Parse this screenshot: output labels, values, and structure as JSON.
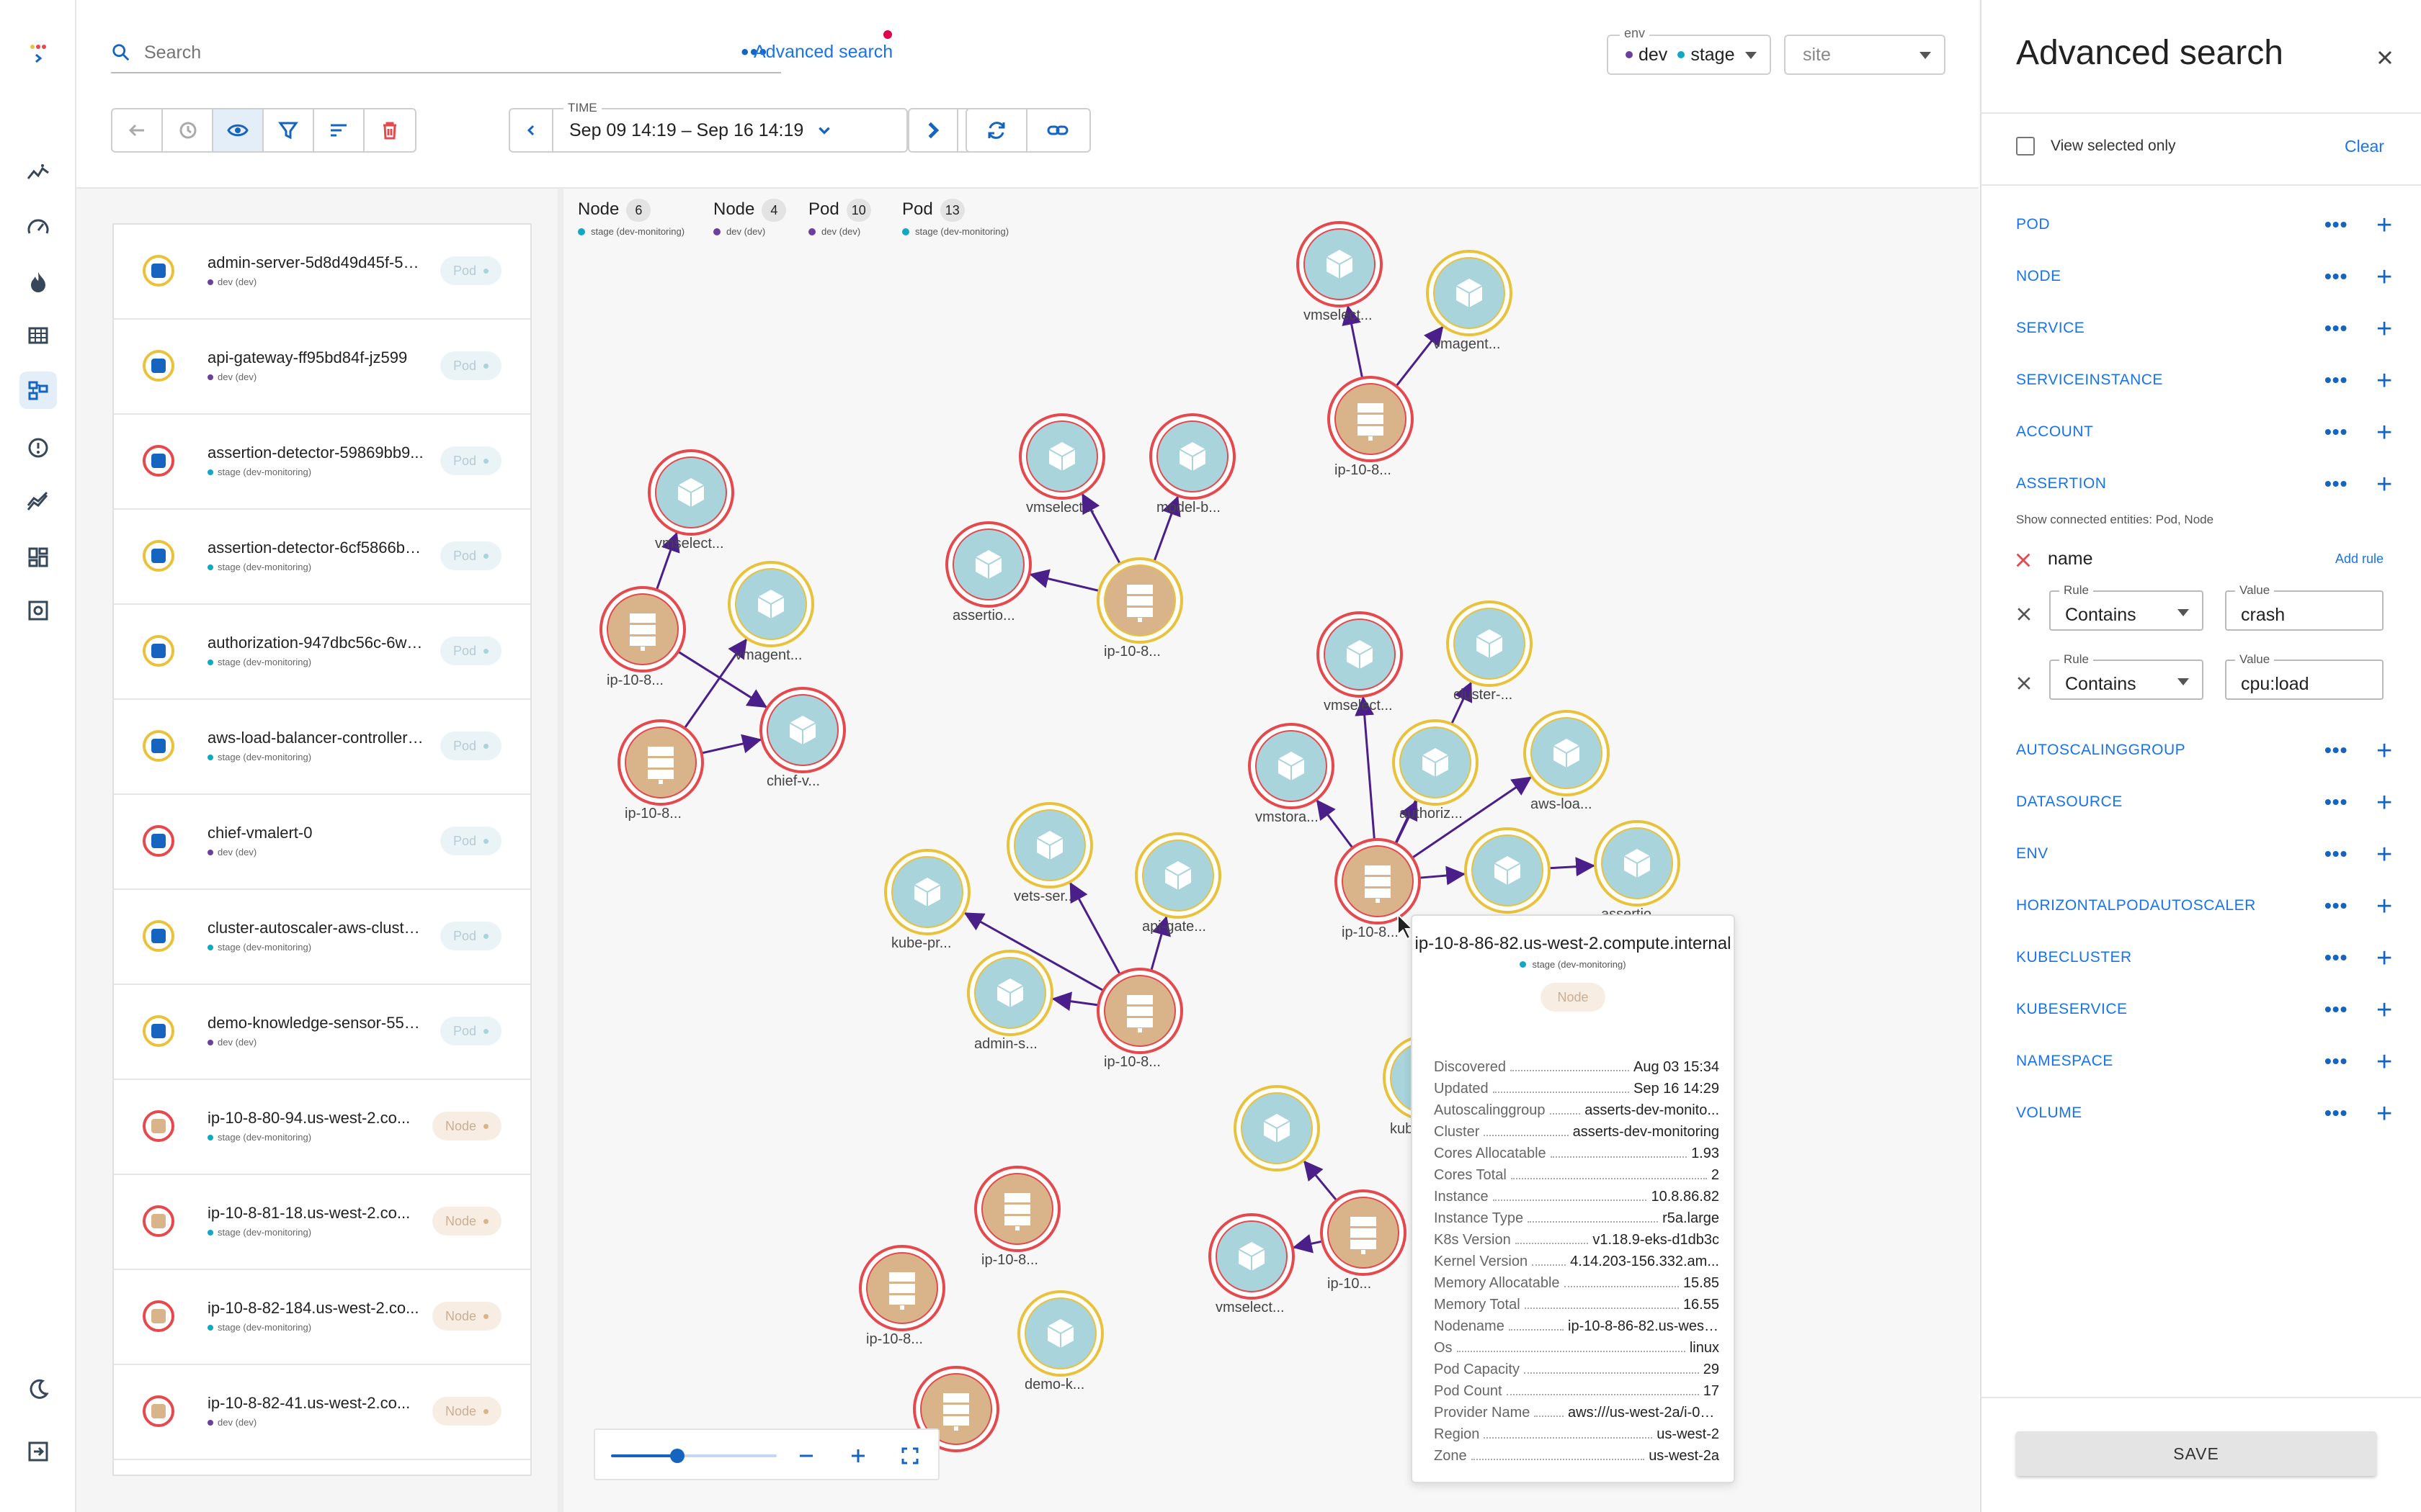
{
  "header": {
    "search_placeholder": "Search",
    "advanced_search_link": "Advanced search",
    "env_label": "env",
    "env_values": [
      "dev",
      "stage"
    ],
    "site_placeholder": "site",
    "time_label": "TIME",
    "time_range": "Sep 09 14:19 – Sep 16 14:19"
  },
  "colors": {
    "accent": "#1a73e8",
    "dev": "#6b3fa0",
    "stage": "#12a7c4",
    "pod_fill": "#a9d4dc",
    "node_fill": "#d9b48a",
    "ring_red": "#e5484d",
    "ring_yellow": "#e8c23a",
    "edge": "#4a1f8a"
  },
  "entities": [
    {
      "name": "admin-server-5d8d49d45f-56...",
      "scope": "dev (dev)",
      "env": "dev",
      "type": "Pod",
      "ring": "yellow"
    },
    {
      "name": "api-gateway-ff95bd84f-jz599",
      "scope": "dev (dev)",
      "env": "dev",
      "type": "Pod",
      "ring": "yellow"
    },
    {
      "name": "assertion-detector-59869bb9...",
      "scope": "stage (dev-monitoring)",
      "env": "stage",
      "type": "Pod",
      "ring": "red"
    },
    {
      "name": "assertion-detector-6cf5866b8...",
      "scope": "stage (dev-monitoring)",
      "env": "stage",
      "type": "Pod",
      "ring": "yellow"
    },
    {
      "name": "authorization-947dbc56c-6wl5z",
      "scope": "stage (dev-monitoring)",
      "env": "stage",
      "type": "Pod",
      "ring": "yellow"
    },
    {
      "name": "aws-load-balancer-controller-...",
      "scope": "stage (dev-monitoring)",
      "env": "stage",
      "type": "Pod",
      "ring": "yellow"
    },
    {
      "name": "chief-vmalert-0",
      "scope": "dev (dev)",
      "env": "dev",
      "type": "Pod",
      "ring": "red"
    },
    {
      "name": "cluster-autoscaler-aws-cluste...",
      "scope": "stage (dev-monitoring)",
      "env": "stage",
      "type": "Pod",
      "ring": "yellow"
    },
    {
      "name": "demo-knowledge-sensor-557...",
      "scope": "dev (dev)",
      "env": "dev",
      "type": "Pod",
      "ring": "yellow"
    },
    {
      "name": "ip-10-8-80-94.us-west-2.co...",
      "scope": "stage (dev-monitoring)",
      "env": "stage",
      "type": "Node",
      "ring": "red"
    },
    {
      "name": "ip-10-8-81-18.us-west-2.co...",
      "scope": "stage (dev-monitoring)",
      "env": "stage",
      "type": "Node",
      "ring": "red"
    },
    {
      "name": "ip-10-8-82-184.us-west-2.co...",
      "scope": "stage (dev-monitoring)",
      "env": "stage",
      "type": "Node",
      "ring": "red"
    },
    {
      "name": "ip-10-8-82-41.us-west-2.co...",
      "scope": "dev (dev)",
      "env": "dev",
      "type": "Node",
      "ring": "red"
    }
  ],
  "legend": [
    {
      "label": "Node",
      "count": "6",
      "scope": "stage (dev-monitoring)",
      "env": "stage"
    },
    {
      "label": "Node",
      "count": "4",
      "scope": "dev (dev)",
      "env": "dev"
    },
    {
      "label": "Pod",
      "count": "10",
      "scope": "dev (dev)",
      "env": "dev"
    },
    {
      "label": "Pod",
      "count": "13",
      "scope": "stage (dev-monitoring)",
      "env": "stage"
    }
  ],
  "graph_labels": [
    "vmselect...",
    "vmagent...",
    "ip-10-8...",
    "vmselect...",
    "model-b...",
    "assertio...",
    "ip-10-8...",
    "vmselect...",
    "ip-10-8...",
    "vmagent...",
    "ip-10-8...",
    "chief-v...",
    "vmselect...",
    "cluster-...",
    "vmstora...",
    "authoriz...",
    "aws-loa...",
    "kube-pr...",
    "ip-10-8...",
    "vets-ser...",
    "kube-pr...",
    "api-gate...",
    "admin-s...",
    "ip-10-8...",
    "kube-p...",
    "assertio...",
    "ip-10-8...",
    "ip-10-8...",
    "vmselect...",
    "ip-10...",
    "demo-k...",
    "ip-10-8..."
  ],
  "tooltip": {
    "title": "ip-10-8-86-82.us-west-2.compute.internal",
    "scope": "stage (dev-monitoring)",
    "type": "Node",
    "props": [
      {
        "k": "Discovered",
        "v": "Aug 03 15:34"
      },
      {
        "k": "Updated",
        "v": "Sep 16 14:29"
      },
      {
        "k": "Autoscalinggroup",
        "v": "asserts-dev-monito..."
      },
      {
        "k": "Cluster",
        "v": "asserts-dev-monitoring"
      },
      {
        "k": "Cores Allocatable",
        "v": "1.93"
      },
      {
        "k": "Cores Total",
        "v": "2"
      },
      {
        "k": "Instance",
        "v": "10.8.86.82"
      },
      {
        "k": "Instance Type",
        "v": "r5a.large"
      },
      {
        "k": "K8s Version",
        "v": "v1.18.9-eks-d1db3c"
      },
      {
        "k": "Kernel Version",
        "v": "4.14.203-156.332.am..."
      },
      {
        "k": "Memory Allocatable",
        "v": "15.85"
      },
      {
        "k": "Memory Total",
        "v": "16.55"
      },
      {
        "k": "Nodename",
        "v": "ip-10-8-86-82.us-west-2.c..."
      },
      {
        "k": "Os",
        "v": "linux"
      },
      {
        "k": "Pod Capacity",
        "v": "29"
      },
      {
        "k": "Pod Count",
        "v": "17"
      },
      {
        "k": "Provider Name",
        "v": "aws:///us-west-2a/i-0c..."
      },
      {
        "k": "Region",
        "v": "us-west-2"
      },
      {
        "k": "Zone",
        "v": "us-west-2a"
      }
    ]
  },
  "zoom_level": 0.4,
  "panel": {
    "title": "Advanced search",
    "view_selected_only": "View selected only",
    "clear": "Clear",
    "sections_top": [
      "POD",
      "NODE",
      "SERVICE",
      "SERVICEINSTANCE",
      "ACCOUNT",
      "ASSERTION"
    ],
    "assertion_hint": "Show connected entities: Pod, Node",
    "filter_name": "name",
    "add_rule": "Add rule",
    "rule_label": "Rule",
    "value_label": "Value",
    "rules": [
      {
        "rule": "Contains",
        "value": "crash"
      },
      {
        "rule": "Contains",
        "value": "cpu:load"
      }
    ],
    "sections_bottom": [
      "AUTOSCALINGGROUP",
      "DATASOURCE",
      "ENV",
      "HORIZONTALPODAUTOSCALER",
      "KUBECLUSTER",
      "KUBESERVICE",
      "NAMESPACE",
      "VOLUME"
    ],
    "save": "SAVE"
  }
}
